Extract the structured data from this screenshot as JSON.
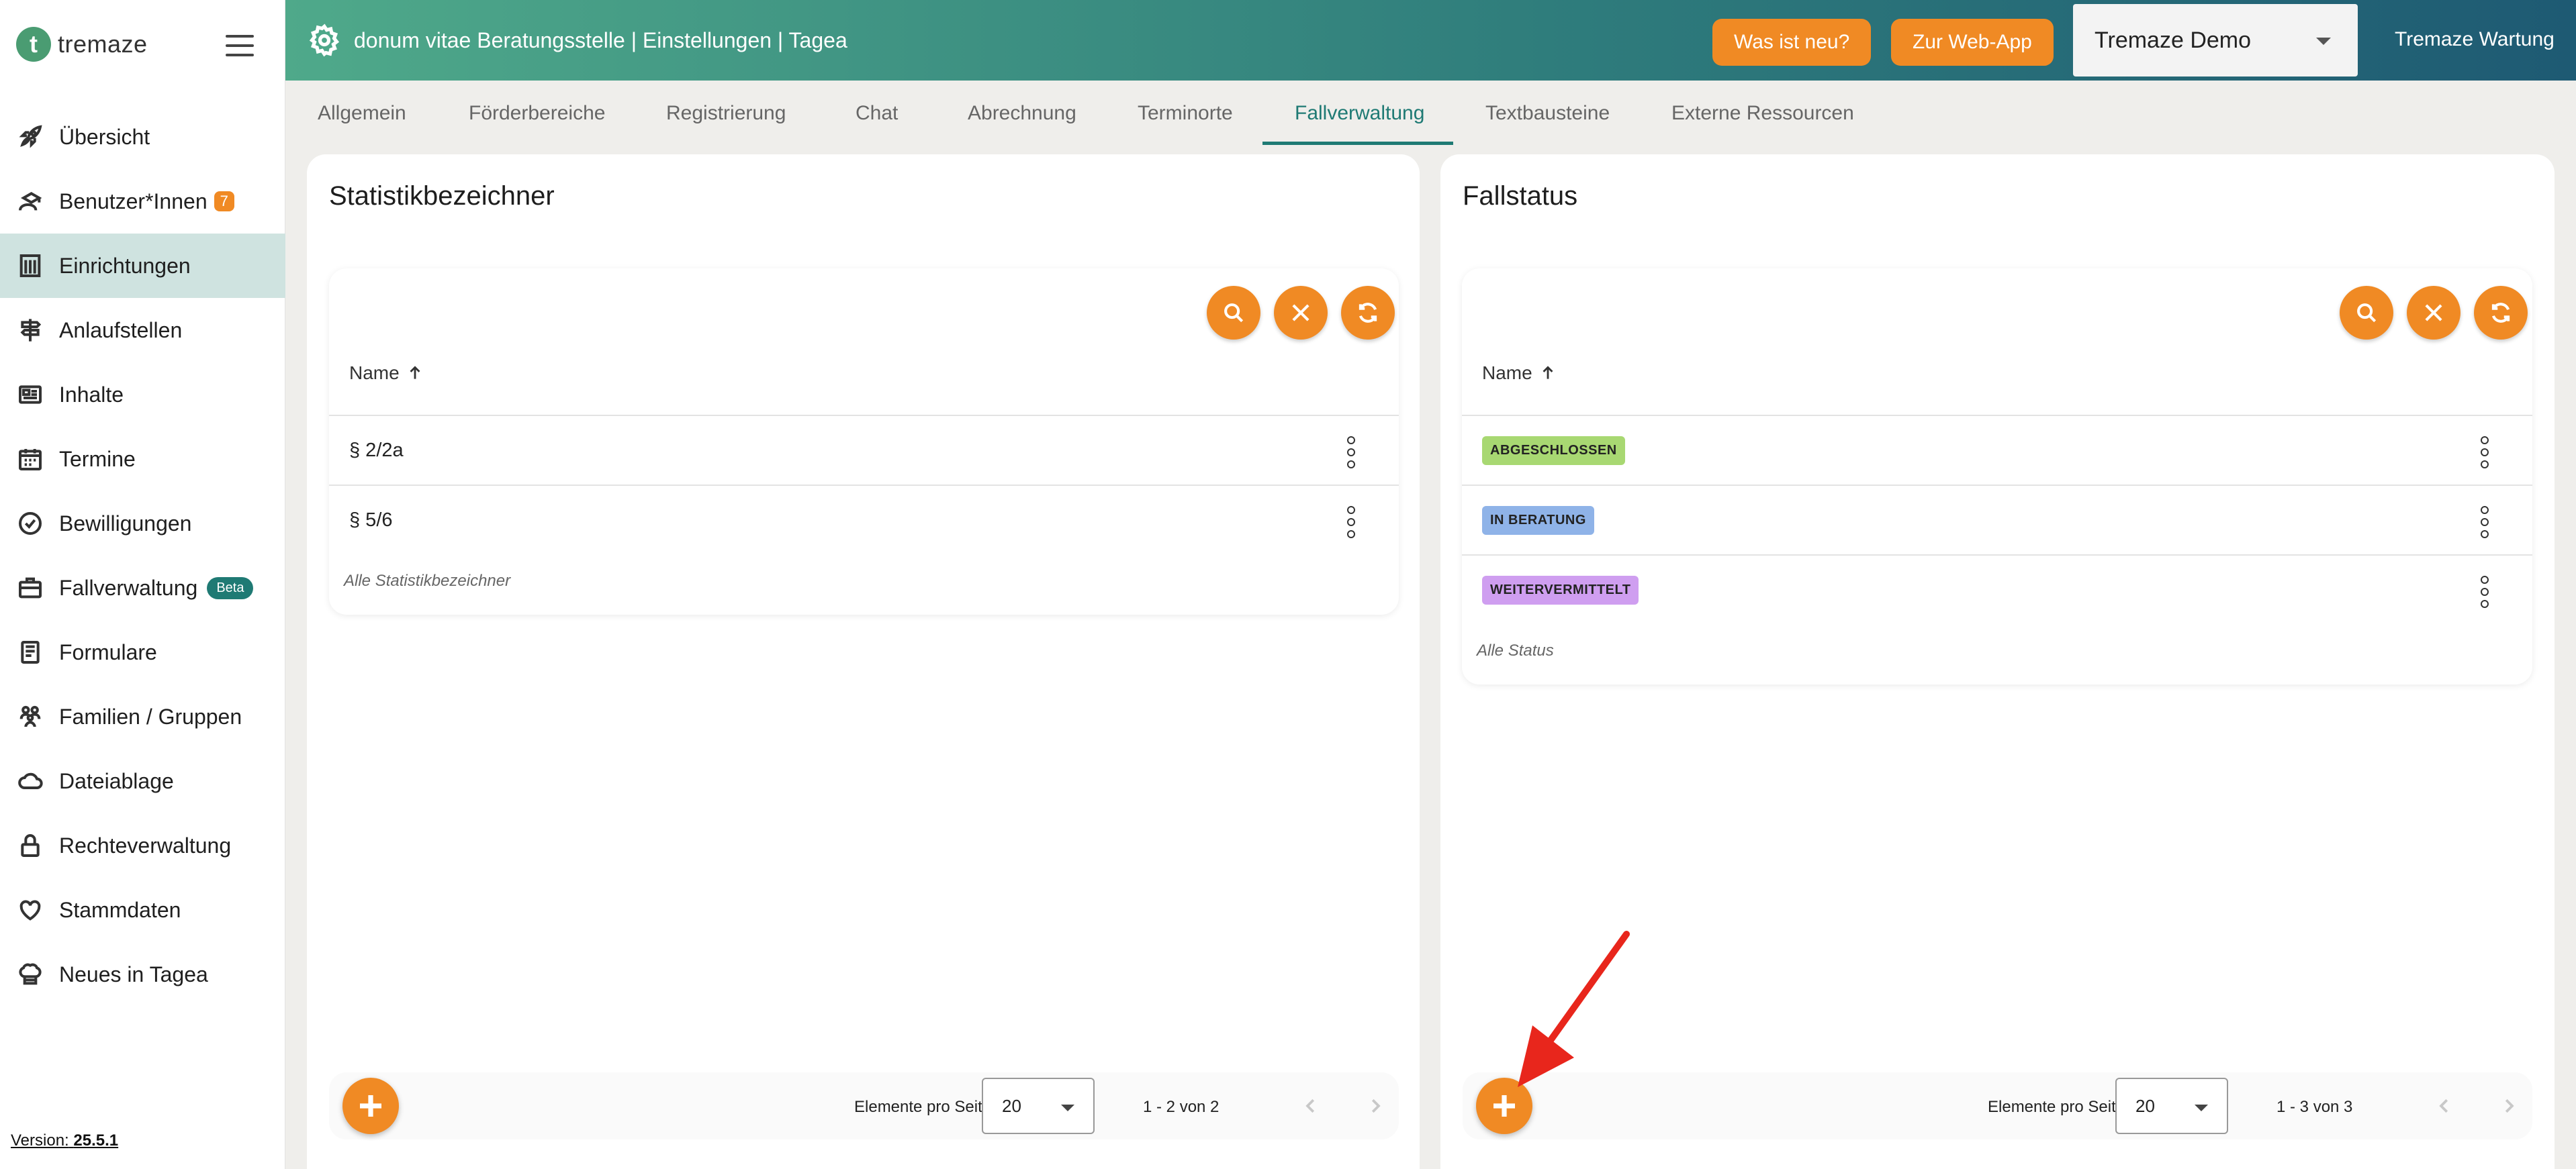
{
  "brand": {
    "logo_letter": "t",
    "logo_text": "tremaze"
  },
  "sidebar": {
    "items": [
      {
        "label": "Übersicht",
        "icon": "rocket-icon"
      },
      {
        "label": "Benutzer*Innen",
        "icon": "users-icon",
        "badge": "7"
      },
      {
        "label": "Einrichtungen",
        "icon": "building-icon",
        "active": true
      },
      {
        "label": "Anlaufstellen",
        "icon": "signpost-icon"
      },
      {
        "label": "Inhalte",
        "icon": "newspaper-icon"
      },
      {
        "label": "Termine",
        "icon": "calendar-icon"
      },
      {
        "label": "Bewilligungen",
        "icon": "check-circle-icon"
      },
      {
        "label": "Fallverwaltung",
        "icon": "briefcase-icon",
        "badge": "Beta"
      },
      {
        "label": "Formulare",
        "icon": "form-icon"
      },
      {
        "label": "Familien / Gruppen",
        "icon": "group-icon"
      },
      {
        "label": "Dateiablage",
        "icon": "cloud-icon"
      },
      {
        "label": "Rechteverwaltung",
        "icon": "lock-icon"
      },
      {
        "label": "Stammdaten",
        "icon": "heart-icon"
      },
      {
        "label": "Neues in Tagea",
        "icon": "chef-hat-icon"
      }
    ],
    "version_label": "Version:",
    "version_value": "25.5.1"
  },
  "header": {
    "title": "donum vitae Beratungsstelle | Einstellungen | Tagea",
    "whats_new": "Was ist neu?",
    "web_app": "Zur Web-App",
    "org_select": "Tremaze Demo",
    "maintenance": "Tremaze Wartung"
  },
  "tabs": [
    {
      "label": "Allgemein"
    },
    {
      "label": "Förderbereiche"
    },
    {
      "label": "Registrierung"
    },
    {
      "label": "Chat"
    },
    {
      "label": "Abrechnung"
    },
    {
      "label": "Terminorte"
    },
    {
      "label": "Fallverwaltung",
      "active": true
    },
    {
      "label": "Textbausteine"
    },
    {
      "label": "Externe Ressourcen"
    }
  ],
  "left_panel": {
    "title": "Statistikbezeichner",
    "column_header": "Name",
    "rows": [
      "§ 2/2a",
      "§ 5/6"
    ],
    "footer": "Alle Statistikbezeichner",
    "per_page_label": "Elemente pro Seite",
    "per_page_value": "20",
    "range": "1 - 2 von 2"
  },
  "right_panel": {
    "title": "Fallstatus",
    "column_header": "Name",
    "rows": [
      {
        "label": "ABGESCHLOSSEN",
        "color": "#a8d872"
      },
      {
        "label": "IN BERATUNG",
        "color": "#8fb3e8"
      },
      {
        "label": "WEITERVERMITTELT",
        "color": "#cf9ef0"
      }
    ],
    "footer": "Alle Status",
    "per_page_label": "Elemente pro Seite",
    "per_page_value": "20",
    "range": "1 - 3 von 3"
  },
  "colors": {
    "accent": "#f08a24",
    "primary": "#1f7a74",
    "active_nav_bg": "#cfe3e0",
    "annotation": "#e8261c"
  }
}
